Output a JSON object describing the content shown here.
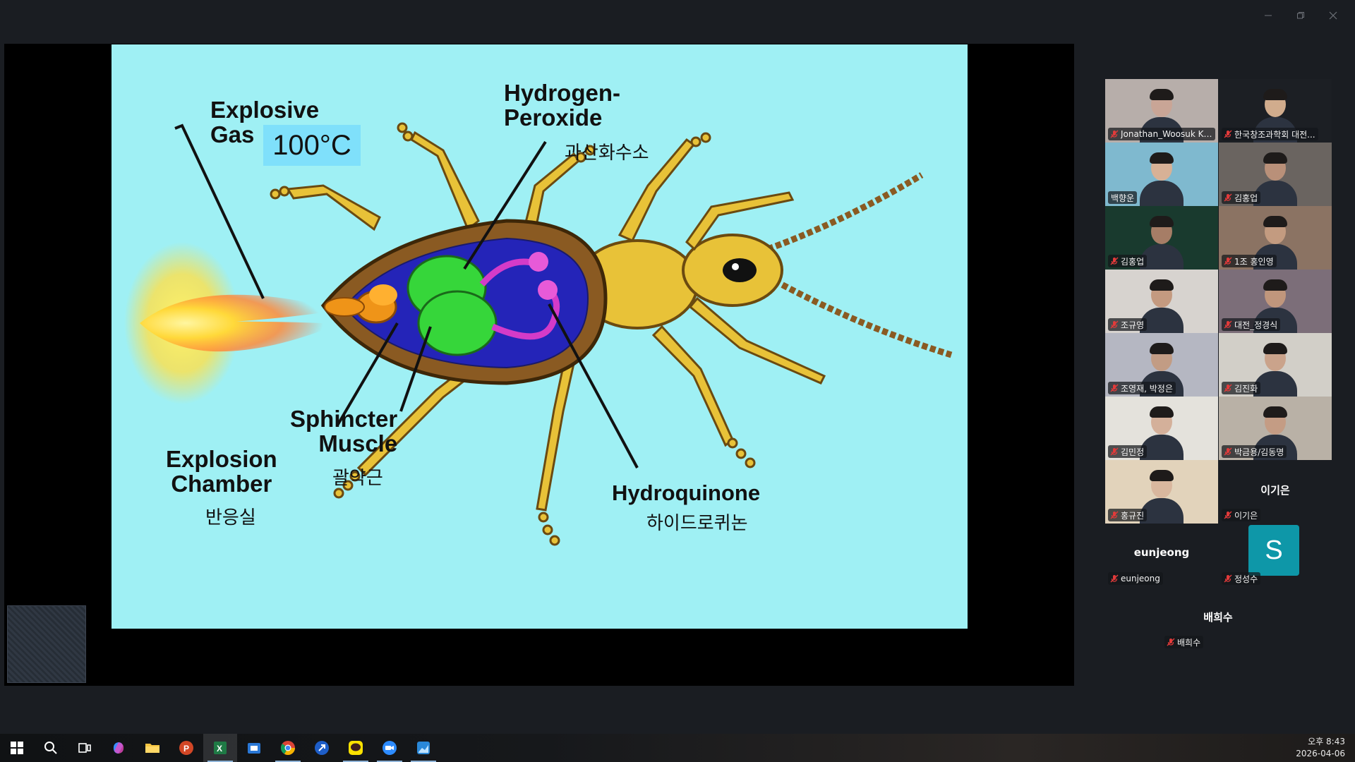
{
  "slide": {
    "explosive_gas_label": "Explosive\nGas",
    "temperature": "100°C",
    "hydrogen_peroxide_label": "Hydrogen-\nPeroxide",
    "hydrogen_peroxide_kr": "과산화수소",
    "sphincter_label": "Sphincter\nMuscle",
    "sphincter_kr": "괄약근",
    "explosion_chamber_label": "Explosion\nChamber",
    "explosion_chamber_kr": "반응실",
    "hydroquinone_label": "Hydroquinone",
    "hydroquinone_kr": "하이드로퀴논",
    "colors": {
      "background": "#9ff0f4",
      "beetle": "#e8c238",
      "shell": "#8a5a22",
      "interior": "#2424b8",
      "gland": "#36d63a",
      "pink": "#d43bc8"
    }
  },
  "participants": [
    {
      "name": "Jonathan_Woosuk Kim",
      "muted": true,
      "video": true,
      "bg": "#b7aeaa",
      "skin": "#c9a596"
    },
    {
      "name": "한국창조과학회 대전...",
      "muted": true,
      "video": true,
      "bg": "#1c1f24",
      "skin": "#d1ac8d"
    },
    {
      "name": "백향운",
      "muted": false,
      "video": true,
      "bg": "#7fb9cf",
      "skin": "#d7b196",
      "active": true
    },
    {
      "name": "김홍업",
      "muted": true,
      "video": true,
      "bg": "#6a6460",
      "skin": "#b99079"
    },
    {
      "name": "김홍업",
      "muted": true,
      "video": true,
      "bg": "#193a2e",
      "skin": "#a67d66"
    },
    {
      "name": "1조 홍인영",
      "muted": true,
      "video": true,
      "bg": "#8b7363",
      "skin": "#c39b80"
    },
    {
      "name": "조규영",
      "muted": true,
      "video": true,
      "bg": "#d7d3cf",
      "skin": "#c49a80"
    },
    {
      "name": "대전_정경식",
      "muted": true,
      "video": true,
      "bg": "#7c6e79",
      "skin": "#c0967c"
    },
    {
      "name": "조영재, 박정은",
      "muted": true,
      "video": true,
      "bg": "#b5b7c2",
      "skin": "#c29c84"
    },
    {
      "name": "김진화",
      "muted": true,
      "video": true,
      "bg": "#d2cfc8",
      "skin": "#caa38b"
    },
    {
      "name": "김민정",
      "muted": true,
      "video": true,
      "bg": "#e4e2dc",
      "skin": "#d4b09a"
    },
    {
      "name": "박금용/김동명",
      "muted": true,
      "video": true,
      "bg": "#b9b1a6",
      "skin": "#c49c84"
    },
    {
      "name": "홍규진",
      "muted": true,
      "video": true,
      "bg": "#e2d3bb",
      "skin": "#d9b79e"
    },
    {
      "name": "이기은",
      "muted": true,
      "video": false
    },
    {
      "name": "eunjeong",
      "muted": true,
      "video": false
    },
    {
      "name": "정성수",
      "muted": true,
      "video": false,
      "avatar_letter": "S"
    },
    {
      "name": "배희수",
      "muted": true,
      "video": false
    }
  ],
  "taskbar": {
    "icons": [
      "windows-start-icon",
      "search-icon",
      "task-view-icon",
      "copilot-icon",
      "file-explorer-icon",
      "powerpoint-icon",
      "excel-icon",
      "store-icon",
      "chrome-icon",
      "arrow-app-icon",
      "kakaotalk-icon",
      "zoom-icon",
      "photo-app-icon"
    ],
    "time": "오후 8:43",
    "date": "2026-04-06"
  }
}
